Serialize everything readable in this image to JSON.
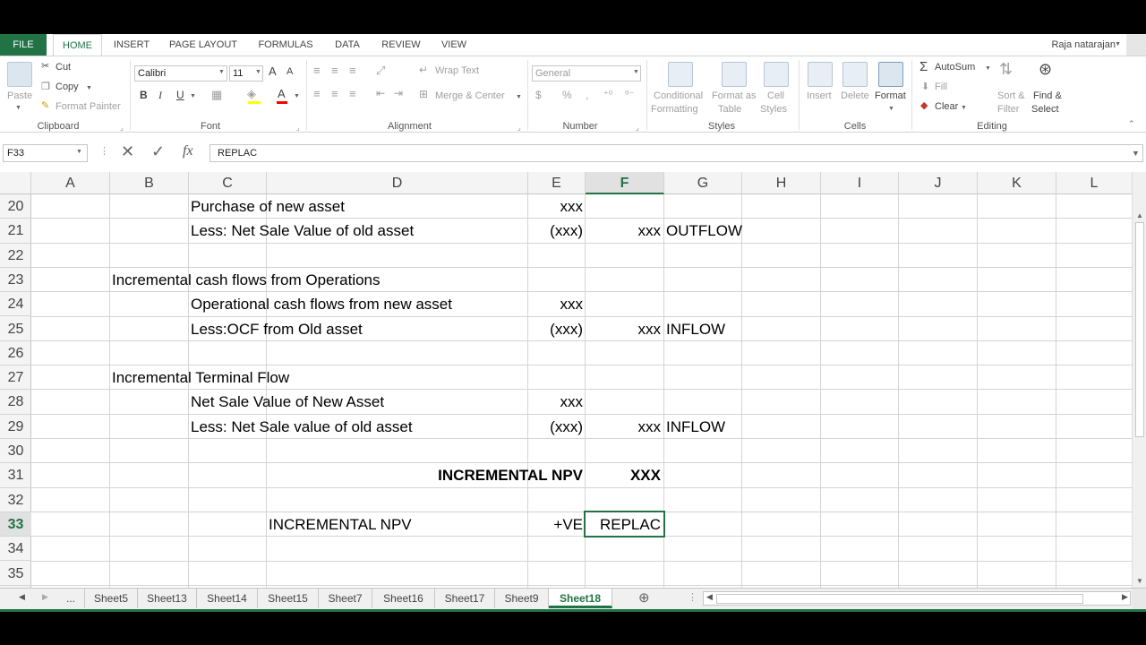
{
  "ribbon_tabs": [
    "FILE",
    "HOME",
    "INSERT",
    "PAGE LAYOUT",
    "FORMULAS",
    "DATA",
    "REVIEW",
    "VIEW"
  ],
  "user_name": "Raja natarajan",
  "clipboard": {
    "paste": "Paste",
    "cut": "Cut",
    "copy": "Copy",
    "format_painter": "Format Painter",
    "group": "Clipboard"
  },
  "font": {
    "name": "Calibri",
    "size": "11",
    "group": "Font",
    "bold": "B",
    "italic": "I",
    "underline": "U",
    "grow": "A",
    "shrink": "A"
  },
  "alignment": {
    "wrap": "Wrap Text",
    "merge": "Merge & Center",
    "group": "Alignment"
  },
  "number": {
    "format": "General",
    "currency": "$",
    "percent": "%",
    "comma": ",",
    "group": "Number"
  },
  "styles": {
    "cond": "Conditional",
    "cond2": "Formatting",
    "table": "Format as",
    "table2": "Table",
    "cell": "Cell",
    "cell2": "Styles",
    "group": "Styles"
  },
  "cells_grp": {
    "insert": "Insert",
    "delete": "Delete",
    "format": "Format",
    "group": "Cells"
  },
  "editing": {
    "autosum": "AutoSum",
    "fill": "Fill",
    "clear": "Clear",
    "sort": "Sort &",
    "sort2": "Filter",
    "find": "Find &",
    "find2": "Select",
    "group": "Editing"
  },
  "formula_bar": {
    "name_box": "F33",
    "fx": "fx",
    "content": "REPLAC"
  },
  "columns": [
    "A",
    "B",
    "C",
    "D",
    "E",
    "F",
    "G",
    "H",
    "I",
    "J",
    "K",
    "L"
  ],
  "rows": [
    "20",
    "21",
    "22",
    "23",
    "24",
    "25",
    "26",
    "27",
    "28",
    "29",
    "30",
    "31",
    "32",
    "33",
    "34",
    "35"
  ],
  "cells": {
    "r20c": "Purchase of new asset",
    "r20e": "xxx",
    "r21c": "Less: Net Sale Value of old asset",
    "r21e": "(xxx)",
    "r21f": "xxx",
    "r21g": "OUTFLOW",
    "r23b": "Incremental cash flows from Operations",
    "r24c": "Operational cash flows from new asset",
    "r24e": "xxx",
    "r25c": "Less:OCF from Old asset",
    "r25e": "(xxx)",
    "r25f": "xxx",
    "r25g": "INFLOW",
    "r27b": "Incremental Terminal Flow",
    "r28c": "Net Sale Value of New Asset",
    "r28e": "xxx",
    "r29c": "Less: Net Sale value of old asset",
    "r29e": "(xxx)",
    "r29f": "xxx",
    "r29g": "INFLOW",
    "r31d": "INCREMENTAL NPV",
    "r31f": "XXX",
    "r33d": "INCREMENTAL NPV",
    "r33e": "+VE",
    "r33f": "REPLAC"
  },
  "sheet_tabs": [
    "...",
    "Sheet5",
    "Sheet13",
    "Sheet14",
    "Sheet15",
    "Sheet7",
    "Sheet16",
    "Sheet17",
    "Sheet9",
    "Sheet18"
  ],
  "active_sheet": "Sheet18",
  "accent": "#217346"
}
